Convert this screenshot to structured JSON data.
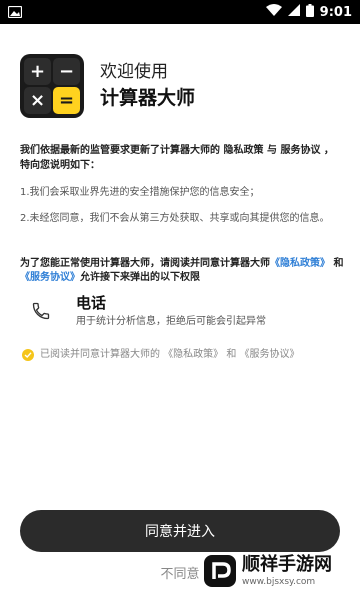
{
  "status_bar": {
    "time": "9:01"
  },
  "app": {
    "welcome": "欢迎使用",
    "name": "计算器大师",
    "logo_symbols": [
      "+",
      "−",
      "×",
      "="
    ]
  },
  "intro": "我们依据最新的监管要求更新了计算器大师的 隐私政策 与 服务协议 ，特向您说明如下：",
  "points": [
    "1.我们会采取业界先进的安全措施保护您的信息安全；",
    "2.未经您同意，我们不会从第三方处获取、共享或向其提供您的信息。"
  ],
  "permission_intro": {
    "prefix": "为了您能正常使用计算器大师，请阅读并同意计算器大师",
    "privacy_link": "《隐私政策》",
    "and": " 和 ",
    "service_link": "《服务协议》",
    "suffix": "允许接下来弹出的以下权限"
  },
  "permission": {
    "title": "电话",
    "description": "用于统计分析信息，拒绝后可能会引起异常"
  },
  "consent": "已阅读并同意计算器大师的 《隐私政策》 和 《服务协议》",
  "buttons": {
    "agree": "同意并进入",
    "disagree": "不同意"
  },
  "watermark": {
    "title": "顺祥手游网",
    "url": "www.bjsxsy.com"
  },
  "colors": {
    "accent_yellow": "#ffd21f",
    "link_blue": "#2f7fd6",
    "button_dark": "#2b2b2b"
  }
}
